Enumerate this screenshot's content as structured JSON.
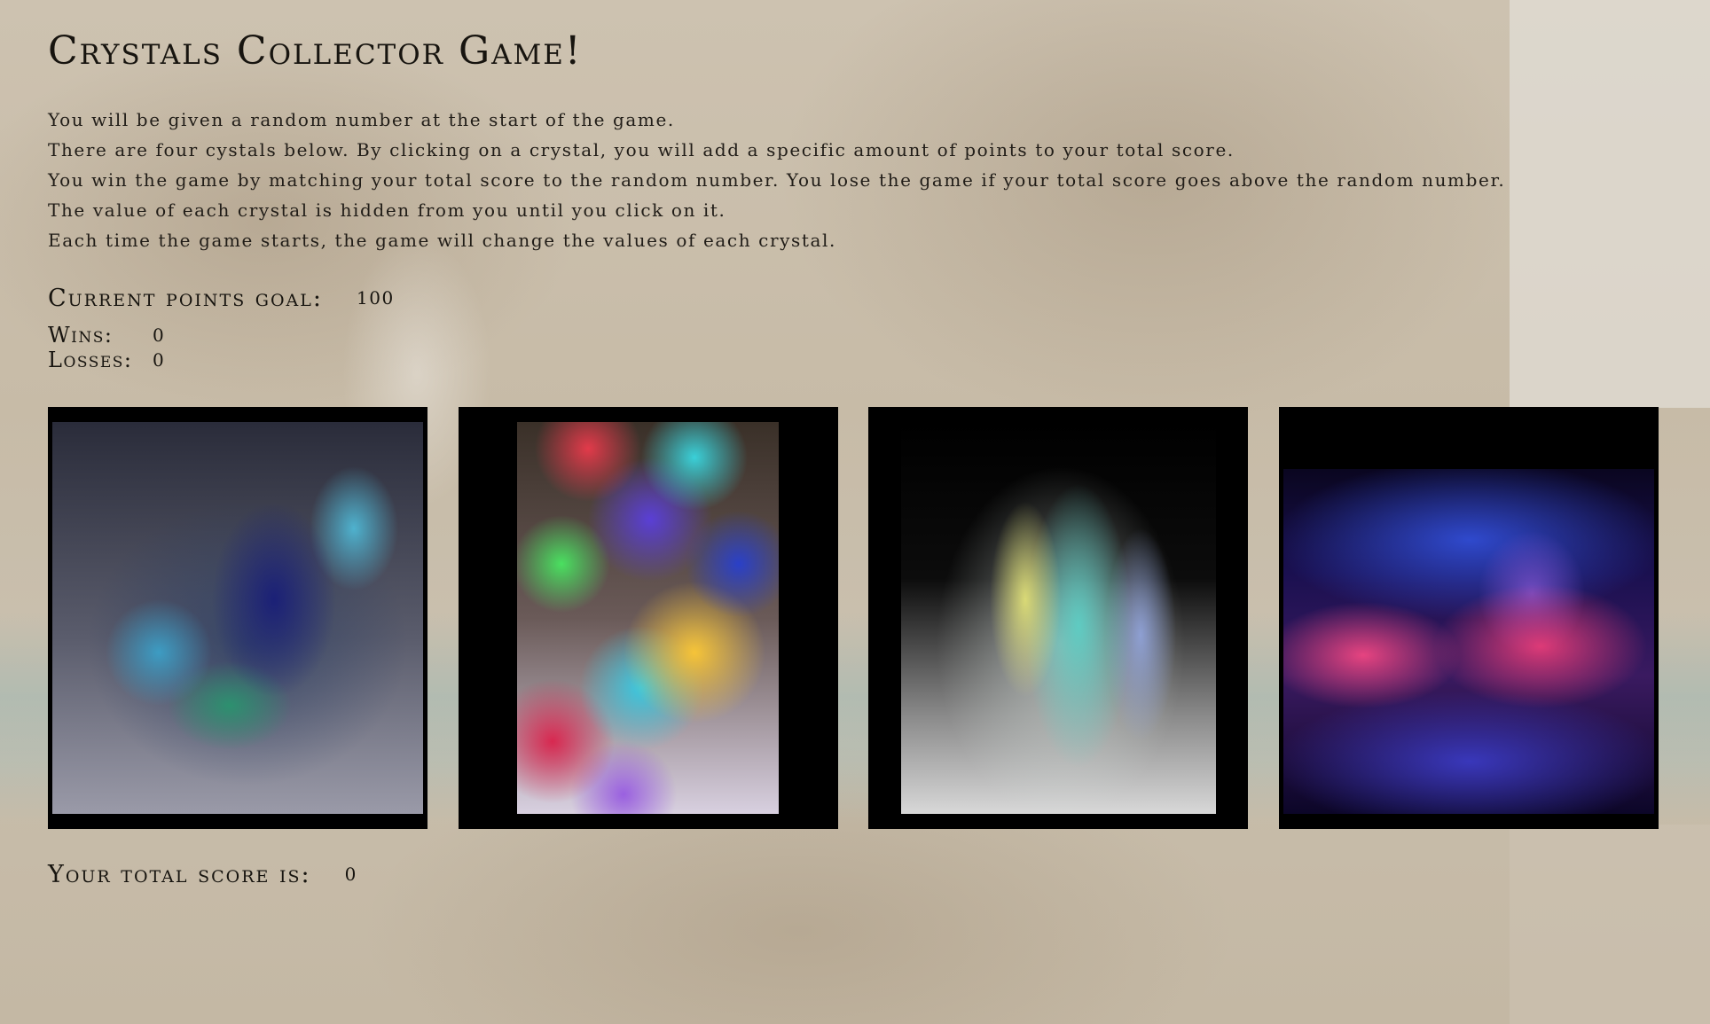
{
  "header": {
    "title": "Crystals Collector Game!"
  },
  "rules": [
    "You will be given a random number at the start of the game.",
    "There are four cystals below. By clicking on a crystal, you will add a specific amount of points to your total score.",
    "You win the game by matching your total score to the random number. You lose the game if your total score goes above the random number.",
    "The value of each crystal is hidden from you until you click on it.",
    "Each time the game starts, the game will change the values of each crystal."
  ],
  "goal": {
    "label": "Current points goal:",
    "value": "100"
  },
  "stats": {
    "wins_label": "Wins:",
    "wins_value": "0",
    "losses_label": "Losses:",
    "losses_value": "0"
  },
  "crystals": [
    {
      "name": "blue-green-crystal"
    },
    {
      "name": "rainbow-crystal"
    },
    {
      "name": "aura-quartz-crystal"
    },
    {
      "name": "pink-geode-crystal"
    }
  ],
  "score": {
    "label": "Your total score is:",
    "value": "0"
  }
}
